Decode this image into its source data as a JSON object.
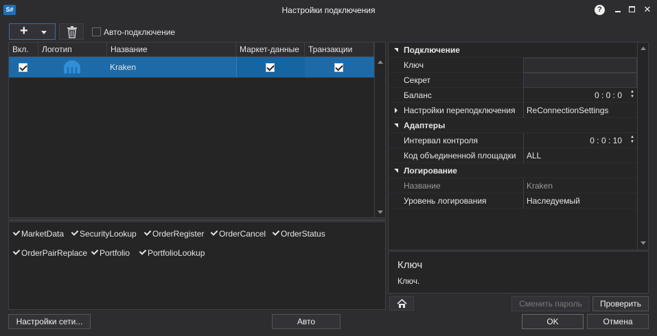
{
  "window": {
    "title": "Настройки подключения",
    "help": "?"
  },
  "toolbar": {
    "auto_connect_label": "Авто-подключение"
  },
  "grid": {
    "columns": [
      "Вкл.",
      "Логотип",
      "Название",
      "Маркет-данные",
      "Транзакции"
    ],
    "rows": [
      {
        "enabled": true,
        "name": "Kraken",
        "market_data": true,
        "transactions": true
      }
    ]
  },
  "messages": {
    "items": [
      "MarketData",
      "SecurityLookup",
      "OrderRegister",
      "OrderCancel",
      "OrderStatus",
      "OrderPairReplace",
      "Portfolio",
      "PortfolioLookup"
    ]
  },
  "properties": {
    "categories": [
      {
        "name": "Подключение",
        "items": [
          {
            "name": "Ключ",
            "value": ""
          },
          {
            "name": "Секрет",
            "value": ""
          },
          {
            "name": "Баланс",
            "value": "0 : 0 : 0"
          },
          {
            "name": "Настройки переподключения",
            "value": "ReConnectionSettings"
          }
        ]
      },
      {
        "name": "Адаптеры",
        "items": [
          {
            "name": "Интервал контроля",
            "value": "0 : 0 : 10"
          },
          {
            "name": "Код объединенной площадки",
            "value": "ALL"
          }
        ]
      },
      {
        "name": "Логирование",
        "items": [
          {
            "name": "Название",
            "value": "Kraken"
          },
          {
            "name": "Уровень логирования",
            "value": "Наследуемый"
          }
        ]
      }
    ],
    "description_title": "Ключ",
    "description_text": "Ключ."
  },
  "buttons": {
    "change_password": "Сменить пароль",
    "verify": "Проверить",
    "network_settings": "Настройки сети...",
    "auto": "Авто",
    "ok": "OK",
    "cancel": "Отмена"
  },
  "colors": {
    "selection": "#1c6aa8",
    "background": "#2d2d30",
    "panel": "#252526"
  }
}
